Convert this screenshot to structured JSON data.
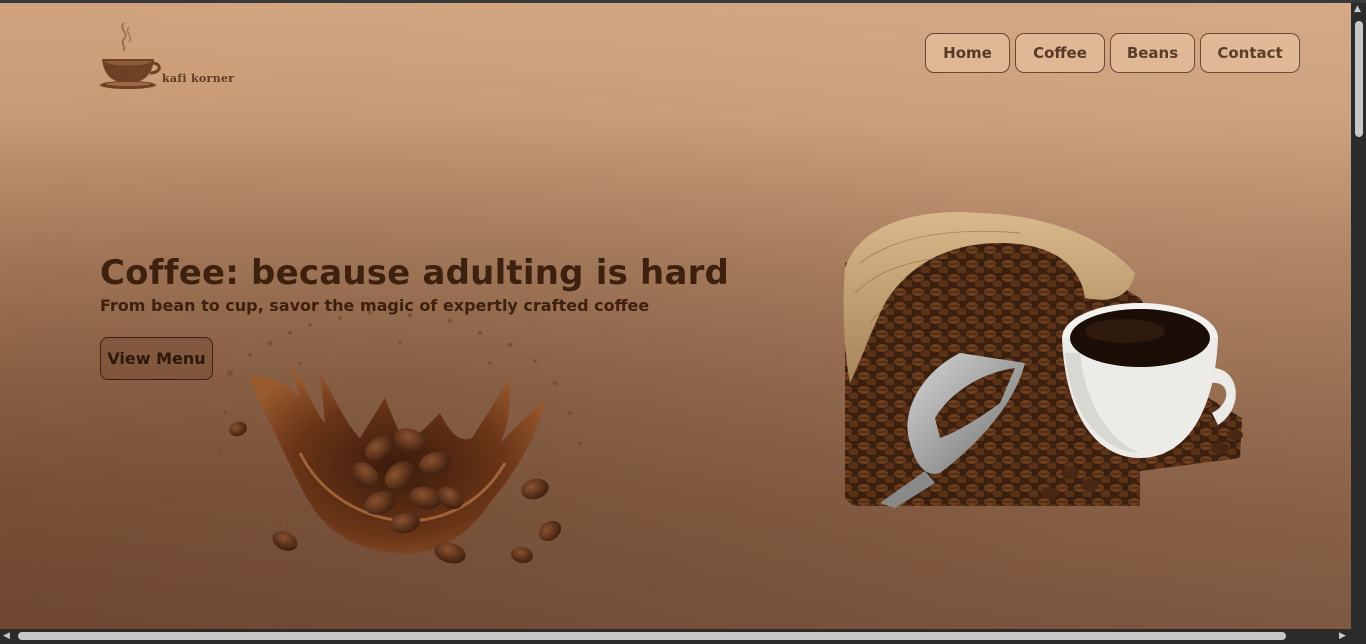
{
  "brand": {
    "name": "kafi korner"
  },
  "nav": {
    "items": [
      {
        "label": "Home"
      },
      {
        "label": "Coffee"
      },
      {
        "label": "Beans"
      },
      {
        "label": "Contact"
      }
    ]
  },
  "hero": {
    "title": "Coffee: because adulting is hard",
    "subtitle": "From bean to cup, savor the magic of expertly crafted coffee",
    "cta_label": "View Menu"
  },
  "images": {
    "logo_icon": "coffee-cup-logo-icon",
    "splash": "coffee-splash-beans-image",
    "bag": "coffee-sack-scoop-cup-image"
  },
  "colors": {
    "text_dark": "#3e200f",
    "nav_border": "#5b3a25",
    "bg_top": "#d0a27e",
    "bg_bottom": "#6f4731"
  }
}
